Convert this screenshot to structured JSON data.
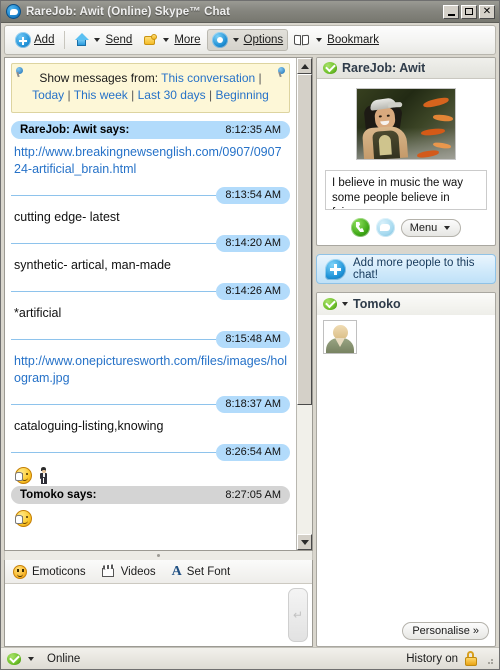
{
  "window": {
    "title": "RareJob: Awit (Online) Skype™ Chat",
    "app_icon": "skype-icon",
    "minimize_label": "",
    "maximize_label": "",
    "close_label": "✕"
  },
  "toolbar": {
    "items": [
      {
        "label": "Add",
        "icon": "add-circle-icon",
        "has_caret": false,
        "pressed": false
      },
      {
        "label": "Send",
        "icon": "up-arrow-icon",
        "has_caret": true,
        "pressed": false
      },
      {
        "label": "More",
        "icon": "puzzle-piece-icon",
        "has_caret": true,
        "pressed": false
      },
      {
        "label": "Options",
        "icon": "options-circle-icon",
        "has_caret": true,
        "pressed": true
      },
      {
        "label": "Bookmark",
        "icon": "book-icon",
        "has_caret": true,
        "pressed": false
      }
    ]
  },
  "banner": {
    "prefix": "Show messages from:",
    "links": [
      "This conversation",
      "Today",
      "This week",
      "Last 30 days",
      "Beginning"
    ],
    "separator": "|"
  },
  "chat": {
    "messages": [
      {
        "kind": "header",
        "author": "RareJob: Awit says:",
        "time": "8:12:35 AM",
        "style": "blue"
      },
      {
        "kind": "link",
        "text": "http://www.breakingnewsenglish.com/0907/090724-artificial_brain.html"
      },
      {
        "kind": "time",
        "time": "8:13:54 AM"
      },
      {
        "kind": "text",
        "text": "cutting edge- latest"
      },
      {
        "kind": "time",
        "time": "8:14:20 AM"
      },
      {
        "kind": "text",
        "text": "synthetic-  artical, man-made"
      },
      {
        "kind": "time",
        "time": "8:14:26 AM"
      },
      {
        "kind": "text",
        "text": "*artificial"
      },
      {
        "kind": "time",
        "time": "8:15:48 AM"
      },
      {
        "kind": "link",
        "text": "http://www.onepicturesworth.com/files/images/hologram.jpg"
      },
      {
        "kind": "time",
        "time": "8:18:37 AM"
      },
      {
        "kind": "text",
        "text": "cataloguing-listing,knowing"
      },
      {
        "kind": "time",
        "time": "8:26:54 AM"
      },
      {
        "kind": "emoticons",
        "icons": [
          "wave-smiley-emoticon",
          "man-emoticon"
        ]
      },
      {
        "kind": "header",
        "author": "Tomoko says:",
        "time": "8:27:05 AM",
        "style": "grey"
      },
      {
        "kind": "emoticons",
        "icons": [
          "wave-smiley-emoticon"
        ]
      }
    ]
  },
  "compose": {
    "tools": [
      {
        "label": "Emoticons",
        "icon": "smiley-icon"
      },
      {
        "label": "Videos",
        "icon": "video-clapper-icon"
      },
      {
        "label": "Set Font",
        "icon": "font-a-icon"
      }
    ],
    "input_value": "",
    "input_placeholder": "",
    "send_glyph": "↵"
  },
  "contact_card": {
    "status_icon": "online-check-icon",
    "name": "RareJob: Awit",
    "avatar": "user-photo",
    "mood_message": "I believe in music the way some people believe in fairy…",
    "actions": [
      {
        "label": "",
        "icon": "call-icon"
      },
      {
        "label": "",
        "icon": "chat-bubble-icon"
      },
      {
        "label": "Menu",
        "icon": "chevron-down-icon"
      }
    ]
  },
  "add_people": {
    "label": "Add more people to this chat!",
    "icon": "add-people-icon"
  },
  "member_card": {
    "status_icon": "online-check-icon",
    "name": "Tomoko",
    "avatar": "default-avatar",
    "personalise_label": "Personalise »"
  },
  "statusbar": {
    "status_icon": "online-check-icon",
    "status_text": "Online",
    "history_text": "History on",
    "history_icon": "lock-icon"
  },
  "colors": {
    "accent_blue": "#2672c8",
    "bubble_blue": "#b2dbfb",
    "bubble_grey": "#d4d4d4",
    "banner_yellow": "#fdf7d7",
    "online_green": "#6fc02a"
  }
}
